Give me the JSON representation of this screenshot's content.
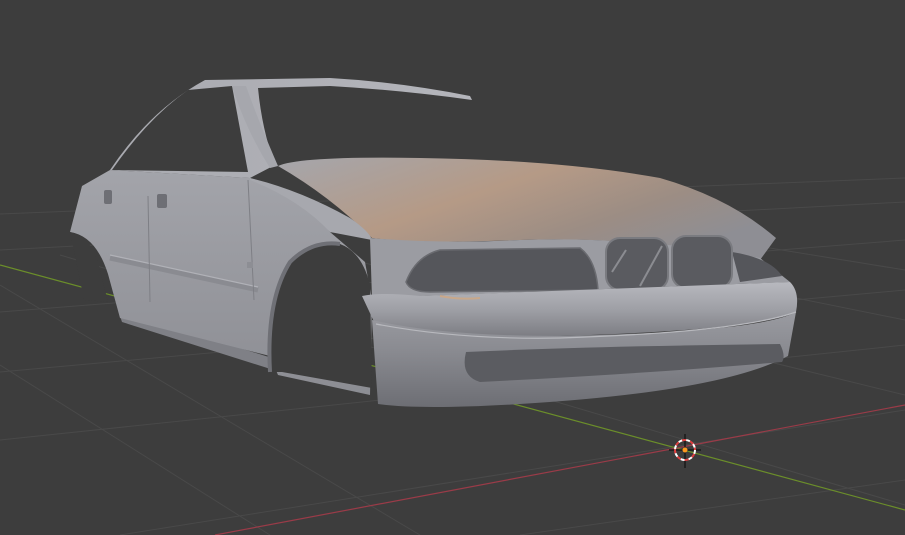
{
  "viewport": {
    "background_color": "#3d3d3d",
    "grid_line_color": "#4a4a4a",
    "x_axis_color": "#9a3b48",
    "y_axis_color": "#6b8e2a",
    "mode": "solid-shading",
    "object": "car-body-mesh",
    "object_color": "#a8a9ae"
  },
  "cursor_3d": {
    "icon": "3d-cursor-icon",
    "ring_colors": [
      "#e04040",
      "#ffffff"
    ],
    "center_color": "#ff9a20"
  }
}
